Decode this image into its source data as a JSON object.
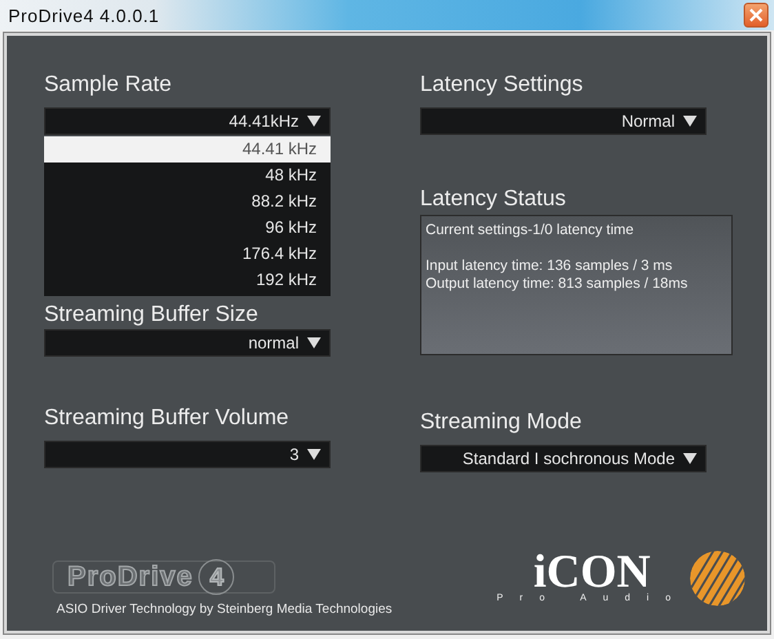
{
  "window": {
    "title": "ProDrive4 4.0.0.1"
  },
  "sample_rate": {
    "label": "Sample Rate",
    "value": "44.41kHz",
    "expanded": true,
    "options": [
      {
        "label": "44.41 kHz",
        "selected": true
      },
      {
        "label": "48 kHz",
        "selected": false
      },
      {
        "label": "88.2 kHz",
        "selected": false
      },
      {
        "label": "96 kHz",
        "selected": false
      },
      {
        "label": "176.4 kHz",
        "selected": false
      },
      {
        "label": "192 kHz",
        "selected": false
      }
    ]
  },
  "streaming_buffer_size": {
    "label": "Streaming Buffer Size",
    "value": "normal"
  },
  "streaming_buffer_volume": {
    "label": "Streaming Buffer Volume",
    "value": "3"
  },
  "latency_settings": {
    "label": "Latency Settings",
    "value": "Normal"
  },
  "latency_status": {
    "label": "Latency Status",
    "heading": "Current settings-1/0 latency time",
    "lines": [
      "Input latency time: 136 samples / 3 ms",
      "Output latency time: 813 samples / 18ms"
    ]
  },
  "streaming_mode": {
    "label": "Streaming Mode",
    "value": "Standard I sochronous Mode"
  },
  "footer": {
    "product_logo": "ProDrive",
    "product_version": "4",
    "credit": "ASIO Driver Technology by Steinberg Media Technologies",
    "brand_logo": "iCON",
    "brand_tagline": "Pro Audio"
  }
}
